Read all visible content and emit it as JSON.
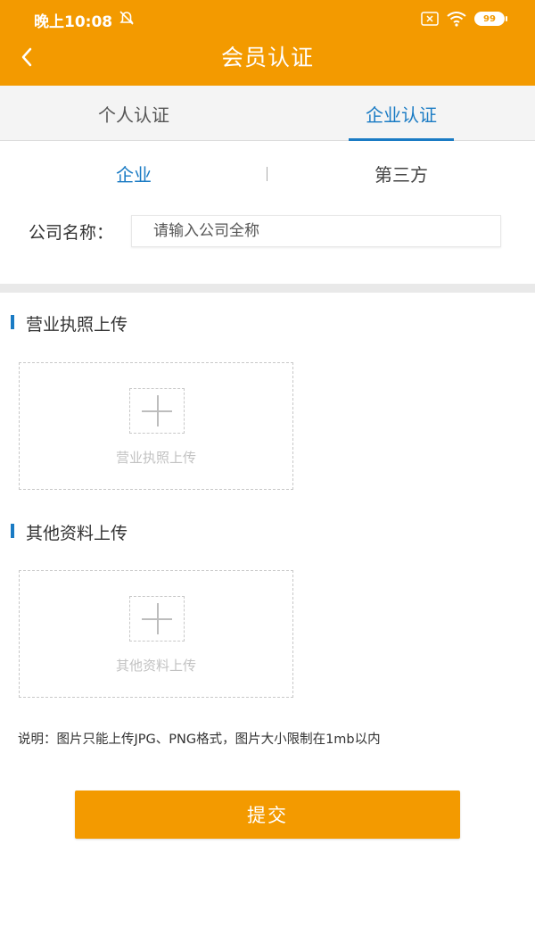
{
  "status_bar": {
    "time": "晚上10:08",
    "battery": "99",
    "icons": [
      "mute-icon",
      "sim-icon",
      "wifi-icon",
      "battery-icon"
    ]
  },
  "header": {
    "title": "会员认证",
    "back_icon": "chevron-left-icon"
  },
  "tabs": {
    "personal": "个人认证",
    "enterprise": "企业认证",
    "active": "enterprise"
  },
  "subtabs": {
    "company": "企业",
    "third_party": "第三方",
    "active": "company"
  },
  "company": {
    "label": "公司名称：",
    "placeholder": "请输入公司全称",
    "value": ""
  },
  "sections": {
    "license": {
      "title": "营业执照上传",
      "upload_label": "营业执照上传"
    },
    "other": {
      "title": "其他资料上传",
      "upload_label": "其他资料上传"
    }
  },
  "note": "说明：图片只能上传JPG、PNG格式，图片大小限制在1mb以内",
  "submit_label": "提交",
  "colors": {
    "accent_orange": "#F39A00",
    "active_blue": "#1A7BC4"
  }
}
